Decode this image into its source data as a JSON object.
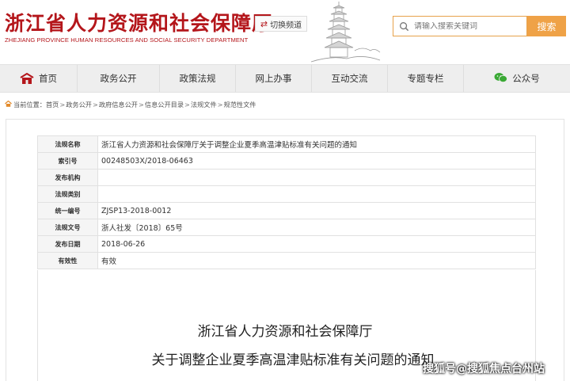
{
  "header": {
    "title": "浙江省人力资源和社会保障厅",
    "subtitle": "ZHEJIANG PROVINCE HUMAN RESOURCES AND SOCIAL SECURITY DEPARTMENT",
    "switch_label": "切换频道",
    "search_placeholder": "请输入搜索关键词",
    "search_button": "搜索"
  },
  "nav": {
    "items": [
      {
        "label": "首页",
        "icon": "home-icon"
      },
      {
        "label": "政务公开"
      },
      {
        "label": "政策法规"
      },
      {
        "label": "网上办事"
      },
      {
        "label": "互动交流"
      },
      {
        "label": "专题专栏"
      },
      {
        "label": "公众号",
        "icon": "wechat-icon"
      }
    ]
  },
  "breadcrumb": {
    "prefix": "当前位置：",
    "items": [
      "首页",
      "政务公开",
      "政府信息公开",
      "信息公开目录",
      "法规文件",
      "规范性文件"
    ],
    "separator": ">"
  },
  "meta": {
    "rows": [
      {
        "label": "法规名称",
        "value": "浙江省人力资源和社会保障厅关于调整企业夏季高温津贴标准有关问题的通知"
      },
      {
        "label": "索引号",
        "value": "00248503X/2018-06463"
      },
      {
        "label": "发布机构",
        "value": ""
      },
      {
        "label": "法规类别",
        "value": ""
      },
      {
        "label": "统一编号",
        "value": "ZJSP13-2018-0012"
      },
      {
        "label": "法规文号",
        "value": "浙人社发〔2018〕65号"
      },
      {
        "label": "发布日期",
        "value": "2018-06-26"
      },
      {
        "label": "有效性",
        "value": "有效"
      }
    ]
  },
  "document": {
    "title_line1": "浙江省人力资源和社会保障厅",
    "title_line2": "关于调整企业夏季高温津贴标准有关问题的通知"
  },
  "watermark": "搜狐号@搜狐焦点台州站",
  "colors": {
    "brand_red": "#b4161b",
    "search_orange": "#efa247",
    "nav_bg": "#eeeeee"
  }
}
